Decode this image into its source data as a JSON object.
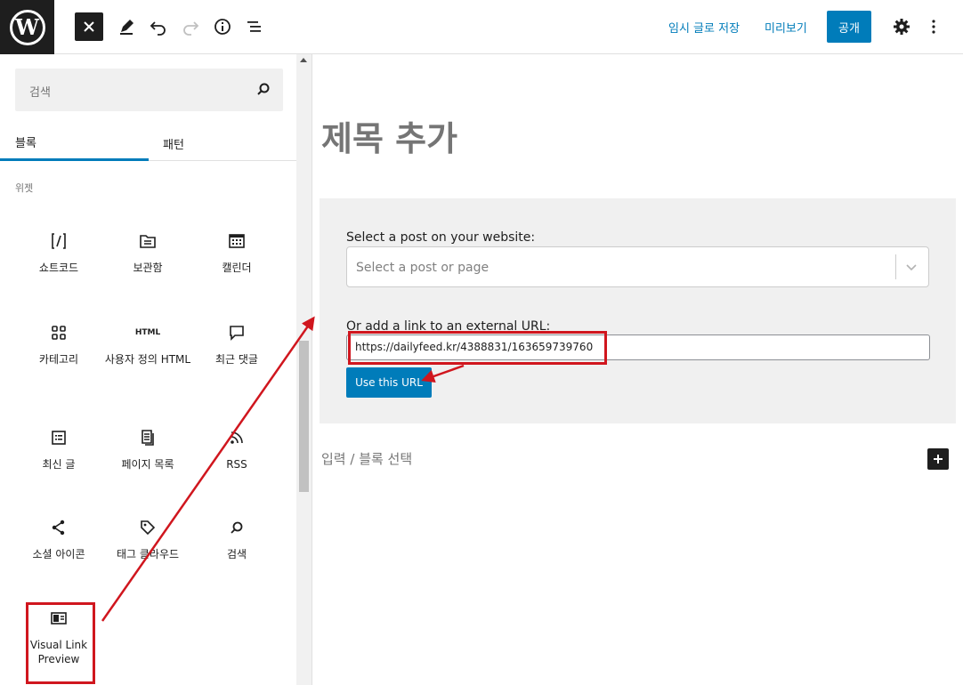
{
  "toolbar": {
    "close_icon": "close-icon",
    "save_draft": "임시 글로 저장",
    "preview": "미리보기",
    "publish": "공개",
    "accent_color": "#007cba"
  },
  "sidebar": {
    "search_placeholder": "검색",
    "tabs": [
      "블록",
      "패턴"
    ],
    "category": "위젯",
    "blocks": [
      {
        "label": "쇼트코드",
        "icon": "shortcode-icon"
      },
      {
        "label": "보관함",
        "icon": "archive-icon"
      },
      {
        "label": "캘린더",
        "icon": "calendar-icon"
      },
      {
        "label": "카테고리",
        "icon": "categories-icon"
      },
      {
        "label": "사용자 정의 HTML",
        "icon": "html-icon",
        "glyph": "HTML"
      },
      {
        "label": "최근 댓글",
        "icon": "comment-icon"
      },
      {
        "label": "최신 글",
        "icon": "post-list-icon"
      },
      {
        "label": "페이지 목록",
        "icon": "page-list-icon"
      },
      {
        "label": "RSS",
        "icon": "rss-icon"
      },
      {
        "label": "소셜 아이콘",
        "icon": "share-icon"
      },
      {
        "label": "태그 클라우드",
        "icon": "tag-icon"
      },
      {
        "label": "검색",
        "icon": "search-icon"
      },
      {
        "label": "Visual Link Preview",
        "icon": "link-preview-icon"
      }
    ]
  },
  "editor": {
    "title_placeholder": "제목 추가",
    "select_label": "Select a post on your website:",
    "select_placeholder": "Select a post or page",
    "url_label": "Or add a link to an external URL:",
    "url_value": "https://dailyfeed.kr/4388831/163659739760",
    "use_url_button": "Use this URL",
    "block_placeholder": "입력 / 블록 선택",
    "annotation_color": "#d0161e"
  }
}
